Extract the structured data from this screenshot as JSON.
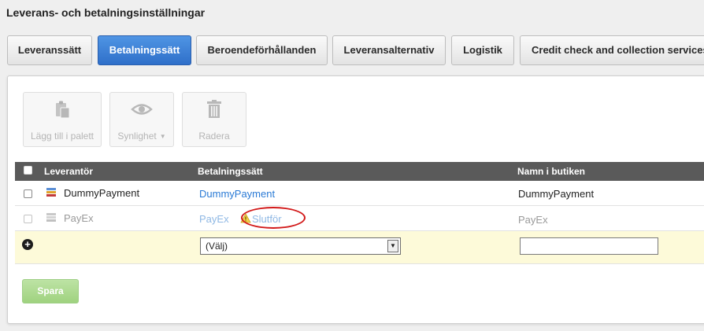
{
  "page": {
    "title": "Leverans- och betalningsinställningar"
  },
  "tabs": [
    {
      "label": "Leveranssätt",
      "active": false
    },
    {
      "label": "Betalningssätt",
      "active": true
    },
    {
      "label": "Beroendeförhållanden",
      "active": false
    },
    {
      "label": "Leveransalternativ",
      "active": false
    },
    {
      "label": "Logistik",
      "active": false
    },
    {
      "label": "Credit check and collection services",
      "active": false
    }
  ],
  "toolbar": {
    "add_to_palette": {
      "label": "Lägg till i palett",
      "icon": "clipboard-add-icon",
      "enabled": false
    },
    "visibility": {
      "label": "Synlighet",
      "icon": "eye-icon",
      "enabled": false
    },
    "delete": {
      "label": "Radera",
      "icon": "trash-icon",
      "enabled": false
    }
  },
  "grid": {
    "columns": [
      "Leverantör",
      "Betalningssätt",
      "Namn i butiken"
    ],
    "rows": [
      {
        "provider": "DummyPayment",
        "method": "DummyPayment",
        "store_name": "DummyPayment",
        "dimmed": false,
        "warning": ""
      },
      {
        "provider": "PayEx",
        "method": "PayEx",
        "store_name": "PayEx",
        "dimmed": true,
        "warning": "Slutför"
      }
    ],
    "new_row": {
      "select_value": "(Välj)",
      "store_name_value": ""
    }
  },
  "actions": {
    "save_label": "Spara"
  },
  "colors": {
    "accent_blue": "#2f6fc9",
    "link": "#2a7ad5",
    "header_bg": "#5a5a5a",
    "new_row_bg": "#fdfad9",
    "save_green": "#9fd27f",
    "highlight_red": "#d21a1a"
  }
}
